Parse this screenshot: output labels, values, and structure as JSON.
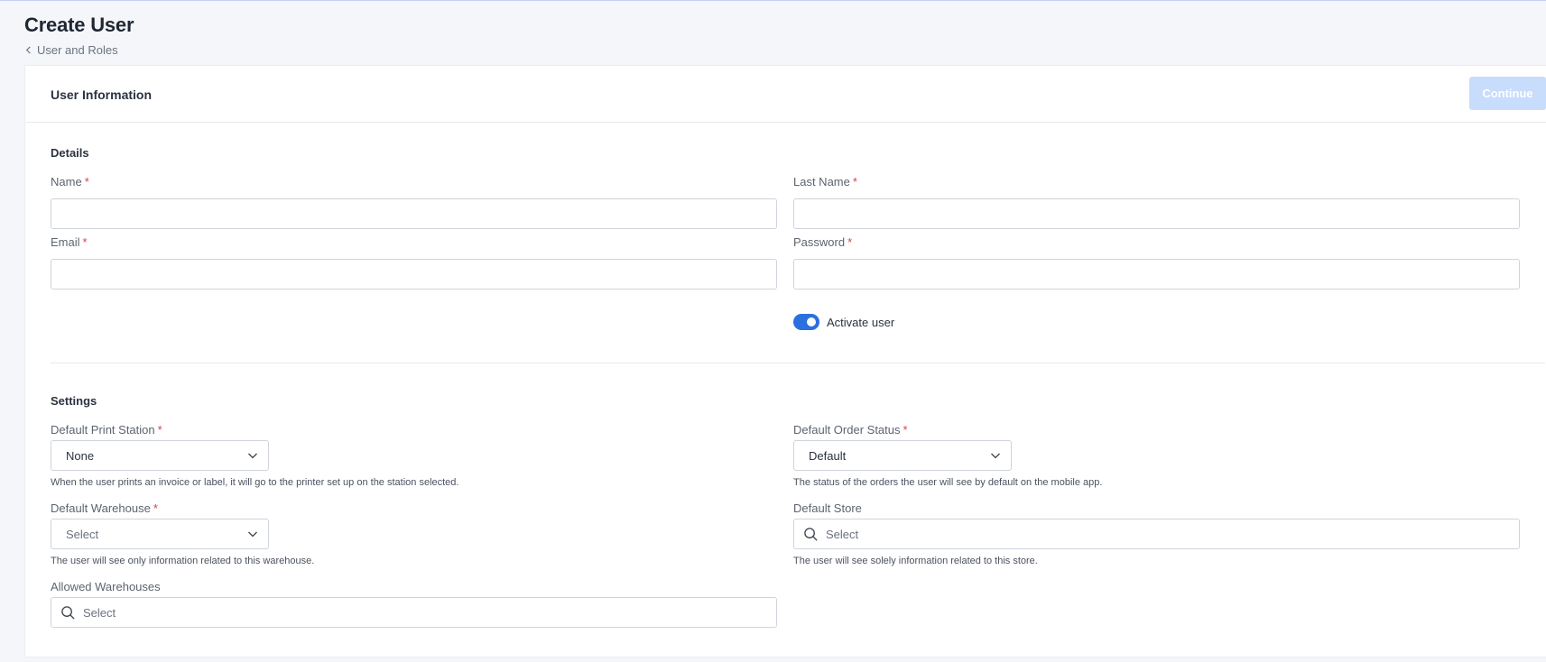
{
  "page": {
    "title": "Create User",
    "breadcrumb": "User and Roles"
  },
  "card": {
    "title": "User Information",
    "continue_label": "Continue"
  },
  "details": {
    "section_title": "Details",
    "name_label": "Name",
    "last_name_label": "Last Name",
    "email_label": "Email",
    "password_label": "Password",
    "required_mark": "*",
    "name_value": "",
    "last_name_value": "",
    "email_value": "",
    "password_value": "",
    "activate_label": "Activate user",
    "activate_on": true
  },
  "settings": {
    "section_title": "Settings",
    "print_station": {
      "label": "Default Print Station",
      "value": "None",
      "help": "When the user prints an invoice or label, it will go to the printer set up on the station selected."
    },
    "order_status": {
      "label": "Default Order Status",
      "value": "Default",
      "help": "The status of the orders the user will see by default on the mobile app."
    },
    "warehouse": {
      "label": "Default Warehouse",
      "placeholder": "Select",
      "help": "The user will see only information related to this warehouse."
    },
    "store": {
      "label": "Default Store",
      "placeholder": "Select",
      "help": "The user will see solely information related to this store."
    },
    "allowed_warehouses": {
      "label": "Allowed Warehouses",
      "placeholder": "Select"
    }
  },
  "colors": {
    "accent": "#2a70df",
    "continue_disabled": "#c8dcfb",
    "required": "#d8424a"
  },
  "icons": {
    "back": "chevron-left-icon",
    "dropdown": "chevron-down-icon",
    "search": "search-icon"
  }
}
